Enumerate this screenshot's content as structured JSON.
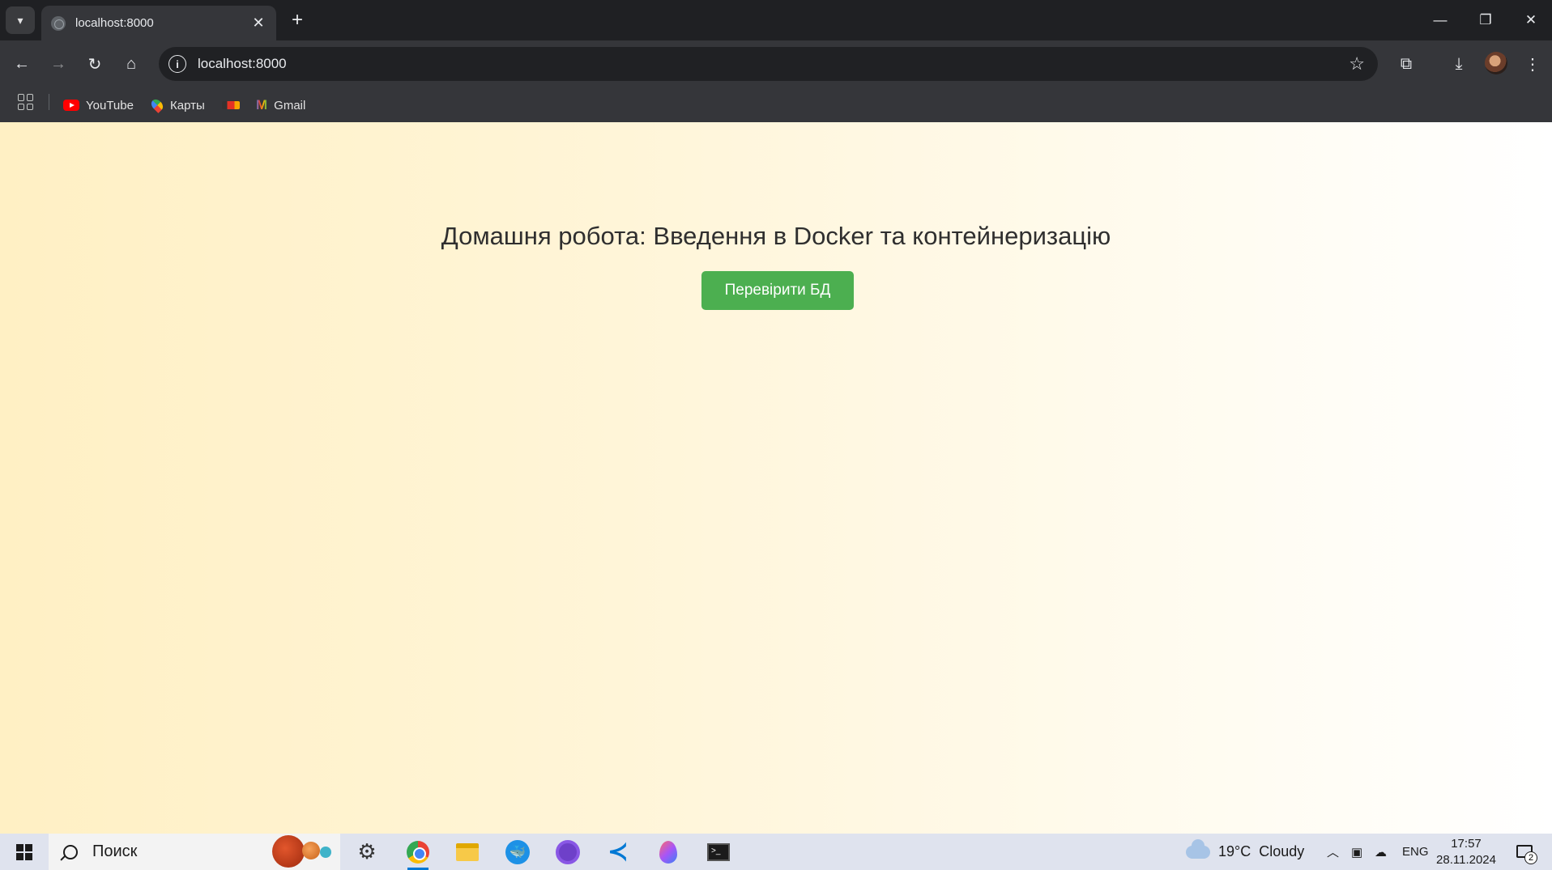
{
  "browser": {
    "tab": {
      "title": "localhost:8000",
      "close": "✕"
    },
    "new_tab": "+",
    "window_controls": {
      "minimize": "—",
      "restore": "❐",
      "close": "✕"
    },
    "address": {
      "url": "localhost:8000"
    },
    "bookmarks": [
      {
        "label": "YouTube",
        "icon": "youtube-icon"
      },
      {
        "label": "Карты",
        "icon": "maps-pin-icon"
      },
      {
        "label": "",
        "icon": "aliexpress-icon"
      },
      {
        "label": "Gmail",
        "icon": "gmail-icon"
      }
    ],
    "colors": {
      "frame": "#1f2023",
      "toolbar": "#35363a",
      "omnibox": "#202124"
    }
  },
  "page": {
    "heading": "Домашня робота: Введення в Docker та контейнеризацію",
    "check_button": "Перевірити БД",
    "colors": {
      "button": "#4caf50",
      "gradient_start": "#fff0c4",
      "gradient_end": "#ffffff"
    }
  },
  "taskbar": {
    "search_placeholder": "Поиск",
    "apps": [
      "settings-icon",
      "chrome-icon",
      "file-explorer-icon",
      "docker-icon",
      "github-desktop-icon",
      "vscode-icon",
      "drop-app-icon",
      "terminal-icon"
    ],
    "weather": {
      "temp": "19°C",
      "condition": "Cloudy"
    },
    "language": "ENG",
    "time": "17:57",
    "date": "28.11.2024",
    "notifications": "2"
  }
}
